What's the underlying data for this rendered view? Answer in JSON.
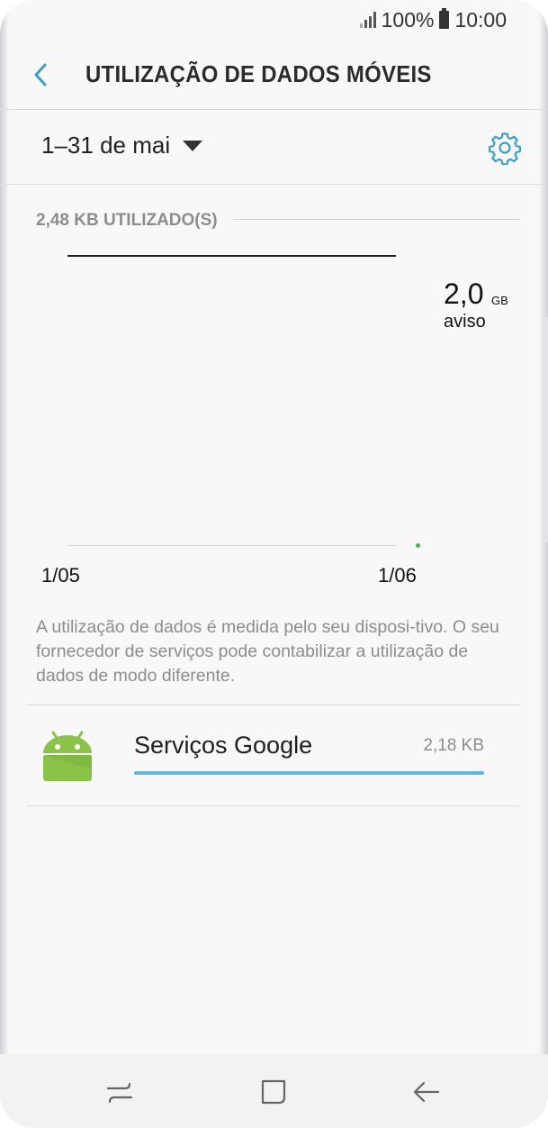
{
  "status_bar": {
    "battery_percent": "100%",
    "time": "10:00"
  },
  "header": {
    "title": "UTILIZAÇÃO DE DADOS MÓVEIS",
    "back_icon": "chevron-left-icon"
  },
  "period": {
    "label": "1–31 de mai",
    "settings_icon": "gear-icon"
  },
  "usage_chart": {
    "used_label": "2,48 KB UTILIZADO(S)",
    "warning_value": "2,0",
    "warning_unit": "GB",
    "warning_label": "aviso",
    "x_start": "1/05",
    "x_end": "1/06"
  },
  "note": "A utilização de dados é medida pelo seu disposi-tivo. O seu fornecedor de serviços pode contabilizar a utilização de dados de modo diferente.",
  "apps": [
    {
      "name": "Serviços Google",
      "usage": "2,18 KB",
      "icon": "android-icon",
      "share_of_max": 1.0
    }
  ],
  "colors": {
    "accent": "#3d9ec4",
    "usage_bar": "#5fb8d8",
    "android_green": "#8bc34a",
    "usage_dot": "#4caf50"
  }
}
